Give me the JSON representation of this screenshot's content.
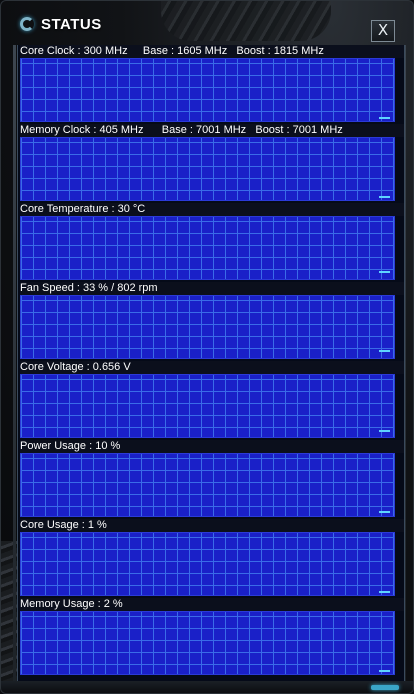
{
  "window": {
    "title": "STATUS",
    "close_label": "X"
  },
  "graphs": [
    {
      "label": "Core Clock : 300 MHz     Base : 1605 MHz   Boost : 1815 MHz",
      "level": 0.05
    },
    {
      "label": "Memory Clock : 405 MHz      Base : 7001 MHz   Boost : 7001 MHz",
      "level": 0.05
    },
    {
      "label": "Core Temperature : 30 °C",
      "level": 0.2
    },
    {
      "label": "Fan Speed : 33 % / 802 rpm",
      "level": 0.2
    },
    {
      "label": "Core Voltage : 0.656 V",
      "level": 0.15
    },
    {
      "label": "Power Usage : 10 %",
      "level": 0.1
    },
    {
      "label": "Core Usage : 1 %",
      "level": 0.05
    },
    {
      "label": "Memory Usage : 2 %",
      "level": 0.05
    }
  ],
  "colors": {
    "graph_background": "#1a20c8",
    "grid": "#3a6be8",
    "trace": "#5ed4ff",
    "accent": "#3aa6c8"
  }
}
